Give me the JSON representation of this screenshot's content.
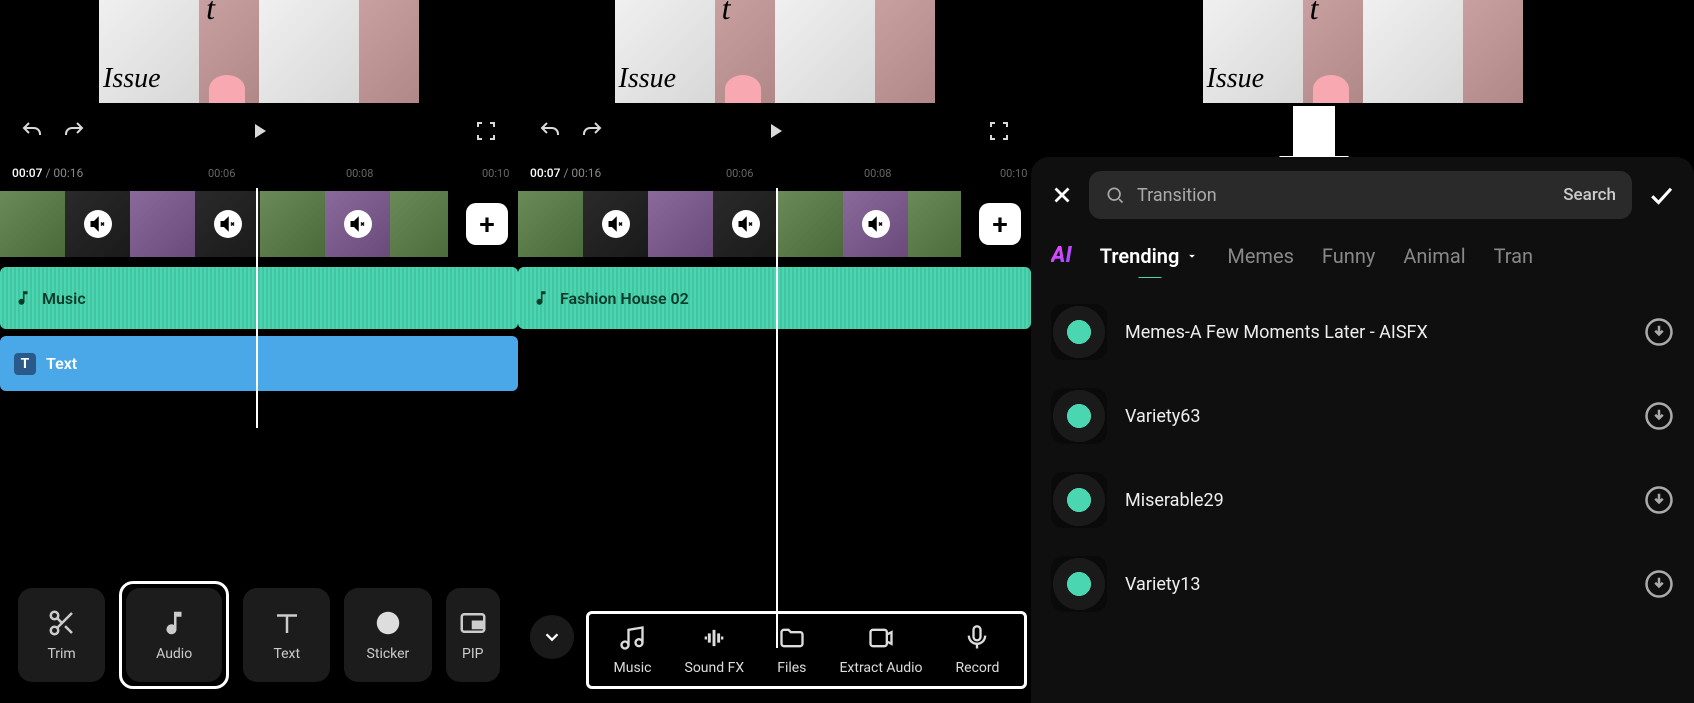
{
  "preview": {
    "text": "Issue"
  },
  "playback": {
    "current": "00:07",
    "total": "00:16"
  },
  "timeline": {
    "ticks": [
      "00:06",
      "00:08",
      "00:10"
    ],
    "audio_label_1": "Music",
    "audio_label_2": "Fashion House 02",
    "text_track_label": "Text",
    "text_track_icon": "T"
  },
  "tools": {
    "trim": "Trim",
    "audio": "Audio",
    "text": "Text",
    "sticker": "Sticker",
    "pip": "PIP"
  },
  "audio_submenu": {
    "music": "Music",
    "soundfx": "Sound FX",
    "files": "Files",
    "extract": "Extract Audio",
    "record": "Record"
  },
  "search_panel": {
    "query": "Transition",
    "search_btn": "Search",
    "ai_badge": "AI",
    "categories": {
      "trending": "Trending",
      "memes": "Memes",
      "funny": "Funny",
      "animal": "Animal",
      "transition": "Tran"
    },
    "sounds": [
      {
        "title": "Memes-A Few Moments Later - AISFX"
      },
      {
        "title": "Variety63"
      },
      {
        "title": "Miserable29"
      },
      {
        "title": "Variety13"
      }
    ]
  }
}
